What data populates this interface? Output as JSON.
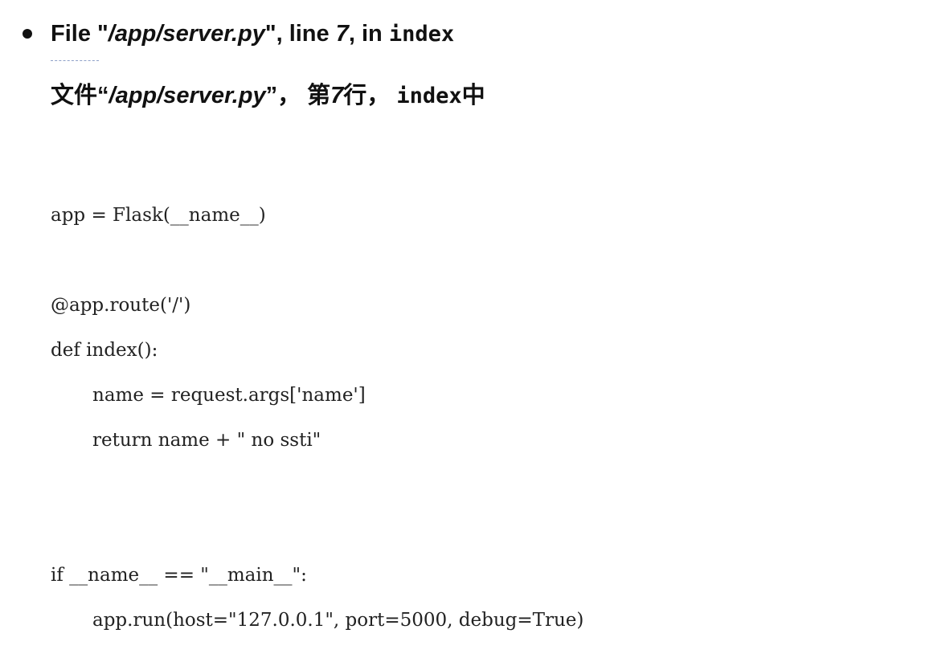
{
  "heading": {
    "prefix": "File \"",
    "path": "/app/server.py",
    "middle": "\", line ",
    "line_no": "7",
    "sep": ", in ",
    "func": "index"
  },
  "heading_zh": {
    "prefix": "文件“",
    "path": "/app/server.py",
    "middle": "”， 第",
    "line_no": "7",
    "sep": "行， ",
    "func": "index",
    "suffix": "中"
  },
  "code_lines": [
    "app = Flask(__name__)",
    "@app.route('/')",
    "def index():",
    "name = request.args['name']",
    "return name + \" no ssti\"",
    "if __name__ == \"__main__\":",
    "app.run(host=\"127.0.0.1\", port=5000, debug=True)"
  ]
}
